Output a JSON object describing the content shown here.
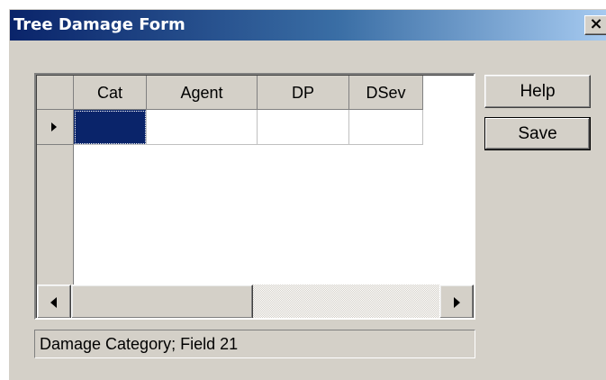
{
  "window": {
    "title": "Tree Damage Form",
    "close_glyph": "✕"
  },
  "grid": {
    "columns": [
      "Cat",
      "Agent",
      "DP",
      "DSev"
    ],
    "rows": [
      {
        "cells": [
          "",
          "",
          "",
          ""
        ],
        "current": true,
        "selected_cell": 0
      }
    ],
    "selection_color": "#0a246a"
  },
  "buttons": {
    "help_label": "Help",
    "save_label": "Save"
  },
  "status": {
    "text": "Damage Category; Field 21"
  },
  "colors": {
    "title_gradient_start": "#0a246a",
    "title_gradient_end": "#a6caf0",
    "dialog_face": "#d4d0c8"
  }
}
